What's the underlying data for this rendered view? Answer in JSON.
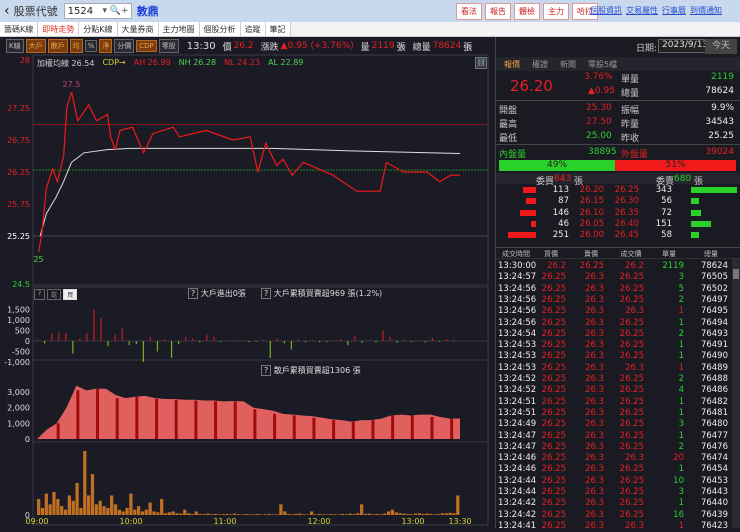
{
  "topbar": {
    "back": "‹",
    "label": "股票代號",
    "code": "1524",
    "code_icons": "▾ 🔍+",
    "name": "敦鼎",
    "buttons": [
      "看法",
      "報告",
      "體檢",
      "主力",
      "哈拉"
    ],
    "links": [
      "個股資訊",
      "交易屬性",
      "行事曆",
      "到價通知"
    ]
  },
  "tabs": [
    "籌碼K線",
    "即時走勢",
    "分點K線",
    "大量券商",
    "主力地圖",
    "個股分析",
    "追蹤",
    "筆記"
  ],
  "toolbar": {
    "buttons": [
      "K線",
      "大戶",
      "散戶",
      "均",
      "%",
      "淨",
      "分價",
      "CDP",
      "零股"
    ],
    "time": "13:30",
    "price_label": "價",
    "price": "26.2",
    "change_label": "漲跌",
    "change": "▲0.95 (+3.76%)",
    "vol_label": "量",
    "vol": "2119",
    "unit": "張",
    "total_label": "總量",
    "total": "78624",
    "unit2": "張"
  },
  "legend": {
    "avg": "加權均線 26.54",
    "cdp": "CDP→",
    "ah": "AH 26.99",
    "nh": "NH 26.28",
    "nl": "NL 24.23",
    "al": "AL 22.89"
  },
  "sub": {
    "tabs": [
      "?",
      "訖",
      "買"
    ],
    "big_out": "大戶進出0張",
    "big_net": "大戶累積買賣超969 張(1.2%)",
    "retail_net": "散戶累積買賣超1306 張",
    "help": "?"
  },
  "chart_data": {
    "type": "line",
    "x_ticks": [
      "09:00",
      "10:00",
      "11:00",
      "12:00",
      "13:00",
      "13:30"
    ],
    "x_tick_minutes": [
      0,
      60,
      120,
      180,
      240,
      270
    ],
    "y_ticks": [
      "28",
      "27.25",
      "26.75",
      "26.25",
      "25.75",
      "25.25",
      "24.5"
    ],
    "ylim": [
      24.5,
      28
    ],
    "high_label": "27.5",
    "low_label": "25",
    "ref_lines": {
      "ah": 26.99,
      "nh": 26.28,
      "prev_close": 25.25
    },
    "price": [
      [
        1,
        25.0
      ],
      [
        3,
        25.27
      ],
      [
        6,
        26.0
      ],
      [
        10,
        26.3
      ],
      [
        13,
        26.1
      ],
      [
        17,
        26.5
      ],
      [
        19,
        27.25
      ],
      [
        22,
        27.5
      ],
      [
        26,
        27.05
      ],
      [
        33,
        27.3
      ],
      [
        38,
        27.05
      ],
      [
        45,
        27.15
      ],
      [
        47,
        26.8
      ],
      [
        50,
        26.6
      ],
      [
        53,
        26.9
      ],
      [
        61,
        26.95
      ],
      [
        68,
        26.55
      ],
      [
        74,
        26.85
      ],
      [
        87,
        26.95
      ],
      [
        91,
        26.8
      ],
      [
        108,
        26.9
      ],
      [
        125,
        26.75
      ],
      [
        136,
        26.8
      ],
      [
        141,
        26.25
      ],
      [
        146,
        26.7
      ],
      [
        153,
        26.35
      ],
      [
        157,
        26.45
      ],
      [
        163,
        26.2
      ],
      [
        170,
        26.4
      ],
      [
        189,
        26.2
      ],
      [
        204,
        25.95
      ],
      [
        219,
        25.95
      ],
      [
        223,
        26.4
      ],
      [
        234,
        26.25
      ],
      [
        249,
        26.25
      ],
      [
        257,
        26.1
      ],
      [
        264,
        26.2
      ],
      [
        270,
        26.2
      ]
    ],
    "avg": [
      [
        2,
        25.25
      ],
      [
        6,
        25.6
      ],
      [
        12,
        25.85
      ],
      [
        17,
        26.1
      ],
      [
        22,
        26.4
      ],
      [
        30,
        26.55
      ],
      [
        45,
        26.6
      ],
      [
        60,
        26.62
      ],
      [
        150,
        26.62
      ],
      [
        200,
        26.58
      ],
      [
        270,
        26.54
      ]
    ],
    "big_ticks": [
      "1,500",
      "1,000",
      "500",
      "0",
      "-500",
      "-1,000"
    ],
    "big_net": [
      80,
      -120,
      350,
      400,
      380,
      -600,
      120,
      380,
      1500,
      1100,
      -250,
      300,
      600,
      -200,
      -150,
      -1000,
      200,
      -500,
      100,
      -800,
      -150,
      200,
      120,
      -60,
      300,
      200,
      -40,
      30,
      -20,
      30,
      -50,
      -40,
      60,
      -800,
      120,
      -120,
      -400,
      80,
      -60,
      40,
      -60,
      -40,
      30,
      90,
      -200,
      250,
      -80,
      20,
      -60,
      500,
      200,
      -80,
      60,
      -40,
      30,
      -60,
      150,
      -40,
      100,
      -30
    ],
    "retail_ticks": [
      "3,000",
      "2,000",
      "1,000",
      "0"
    ],
    "retail_cum": [
      0,
      600,
      1000,
      2000,
      3400,
      3100,
      3200,
      3200,
      2800,
      2600,
      2700,
      2750,
      2600,
      2550,
      2550,
      2500,
      2500,
      2450,
      2450,
      2400,
      2420,
      2400,
      2000,
      1900,
      1800,
      1600,
      1550,
      1500,
      1450,
      1350,
      1250,
      1200,
      1100,
      1200,
      1200,
      1300,
      1500,
      1550,
      1500,
      1550,
      1550,
      1400,
      1300,
      1306
    ],
    "volume_zero": "0",
    "volume": [
      900,
      400,
      1200,
      600,
      1300,
      900,
      500,
      300,
      1100,
      800,
      1800,
      400,
      3600,
      1100,
      2300,
      600,
      800,
      500,
      400,
      1100,
      600,
      300,
      200,
      400,
      1200,
      300,
      500,
      200,
      300,
      700,
      200,
      150,
      900,
      100,
      150,
      200,
      100,
      80,
      300,
      100,
      60,
      200,
      60,
      50,
      80,
      40,
      60,
      40,
      50,
      60,
      40,
      80,
      40,
      30,
      50,
      40,
      40,
      60,
      30,
      40,
      60,
      30,
      40,
      600,
      200,
      60,
      40,
      60,
      80,
      40,
      30,
      200,
      40,
      60,
      40,
      30,
      50,
      40,
      30,
      60,
      40,
      80,
      50,
      100,
      600,
      60,
      80,
      40,
      60,
      40,
      80,
      200,
      300,
      150,
      100,
      80,
      60,
      40,
      80,
      100,
      60,
      80,
      60,
      40,
      50,
      100,
      100,
      120,
      100,
      1100
    ]
  },
  "quote": {
    "date_label": "日期:",
    "date": "2023/9/13",
    "today": "今天",
    "tabs": [
      "報價",
      "權證",
      "新聞",
      "零股5檔"
    ],
    "price": "26.20",
    "pct": "3.76%",
    "chg": "▲0.95",
    "single_label": "單量",
    "single": "2119",
    "total_label": "總量",
    "total": "78624",
    "open_label": "開盤",
    "open": "25.30",
    "amp_label": "振幅",
    "amp": "9.9%",
    "high_label": "最高",
    "high": "27.50",
    "prevvol_label": "昨量",
    "prevvol": "34543",
    "low_label": "最低",
    "low": "25.00",
    "prevclose_label": "昨收",
    "prevclose": "25.25",
    "inner_label": "內盤量",
    "inner": "38895",
    "outer_label": "外盤量",
    "outer": "39024",
    "inner_pct": 49,
    "outer_pct": 51,
    "inner_pct_text": "49%",
    "outer_pct_text": "51%",
    "bid_label": "委買",
    "bid_total": "643",
    "ask_label": "委賣",
    "ask_total": "680",
    "unit": "張",
    "book": [
      [
        "113",
        "26.20",
        "26.25",
        "343"
      ],
      [
        "87",
        "26.15",
        "26.30",
        "56"
      ],
      [
        "146",
        "26.10",
        "26.35",
        "72"
      ],
      [
        "46",
        "26.05",
        "26.40",
        "151"
      ],
      [
        "251",
        "26.00",
        "26.45",
        "58"
      ]
    ]
  },
  "trades": {
    "headers": [
      "成交時間",
      "買價",
      "賣價",
      "成交價",
      "單量",
      "總量"
    ],
    "rows": [
      [
        "13:30:00",
        "26.2",
        "26.25",
        "26.2",
        "2119",
        "78624"
      ],
      [
        "13:24:57",
        "26.25",
        "26.3",
        "26.25",
        "3",
        "76505"
      ],
      [
        "13:24:56",
        "26.25",
        "26.3",
        "26.25",
        "5",
        "76502"
      ],
      [
        "13:24:56",
        "26.25",
        "26.3",
        "26.25",
        "2",
        "76497"
      ],
      [
        "13:24:56",
        "26.25",
        "26.3",
        "26.3",
        "1",
        "76495"
      ],
      [
        "13:24:56",
        "26.25",
        "26.3",
        "26.25",
        "1",
        "76494"
      ],
      [
        "13:24:54",
        "26.25",
        "26.3",
        "26.25",
        "2",
        "76493"
      ],
      [
        "13:24:53",
        "26.25",
        "26.3",
        "26.25",
        "1",
        "76491"
      ],
      [
        "13:24:53",
        "26.25",
        "26.3",
        "26.25",
        "1",
        "76490"
      ],
      [
        "13:24:53",
        "26.25",
        "26.3",
        "26.3",
        "1",
        "76489"
      ],
      [
        "13:24:52",
        "26.25",
        "26.3",
        "26.25",
        "2",
        "76488"
      ],
      [
        "13:24:52",
        "26.25",
        "26.3",
        "26.25",
        "4",
        "76486"
      ],
      [
        "13:24:51",
        "26.25",
        "26.3",
        "26.25",
        "1",
        "76482"
      ],
      [
        "13:24:51",
        "26.25",
        "26.3",
        "26.25",
        "1",
        "76481"
      ],
      [
        "13:24:49",
        "26.25",
        "26.3",
        "26.25",
        "3",
        "76480"
      ],
      [
        "13:24:47",
        "26.25",
        "26.3",
        "26.25",
        "1",
        "76477"
      ],
      [
        "13:24:47",
        "26.25",
        "26.3",
        "26.25",
        "2",
        "76476"
      ],
      [
        "13:24:46",
        "26.25",
        "26.3",
        "26.3",
        "20",
        "76474"
      ],
      [
        "13:24:46",
        "26.25",
        "26.3",
        "26.25",
        "1",
        "76454"
      ],
      [
        "13:24:44",
        "26.25",
        "26.3",
        "26.25",
        "10",
        "76453"
      ],
      [
        "13:24:44",
        "26.25",
        "26.3",
        "26.25",
        "3",
        "76443"
      ],
      [
        "13:24:42",
        "26.25",
        "26.3",
        "26.25",
        "1",
        "76440"
      ],
      [
        "13:24:42",
        "26.25",
        "26.3",
        "26.25",
        "16",
        "76439"
      ],
      [
        "13:24:41",
        "26.25",
        "26.3",
        "26.3",
        "1",
        "76423"
      ]
    ]
  },
  "colors": {
    "up": "#e52020",
    "down": "#2bd12b",
    "accent": "#f0a040"
  }
}
